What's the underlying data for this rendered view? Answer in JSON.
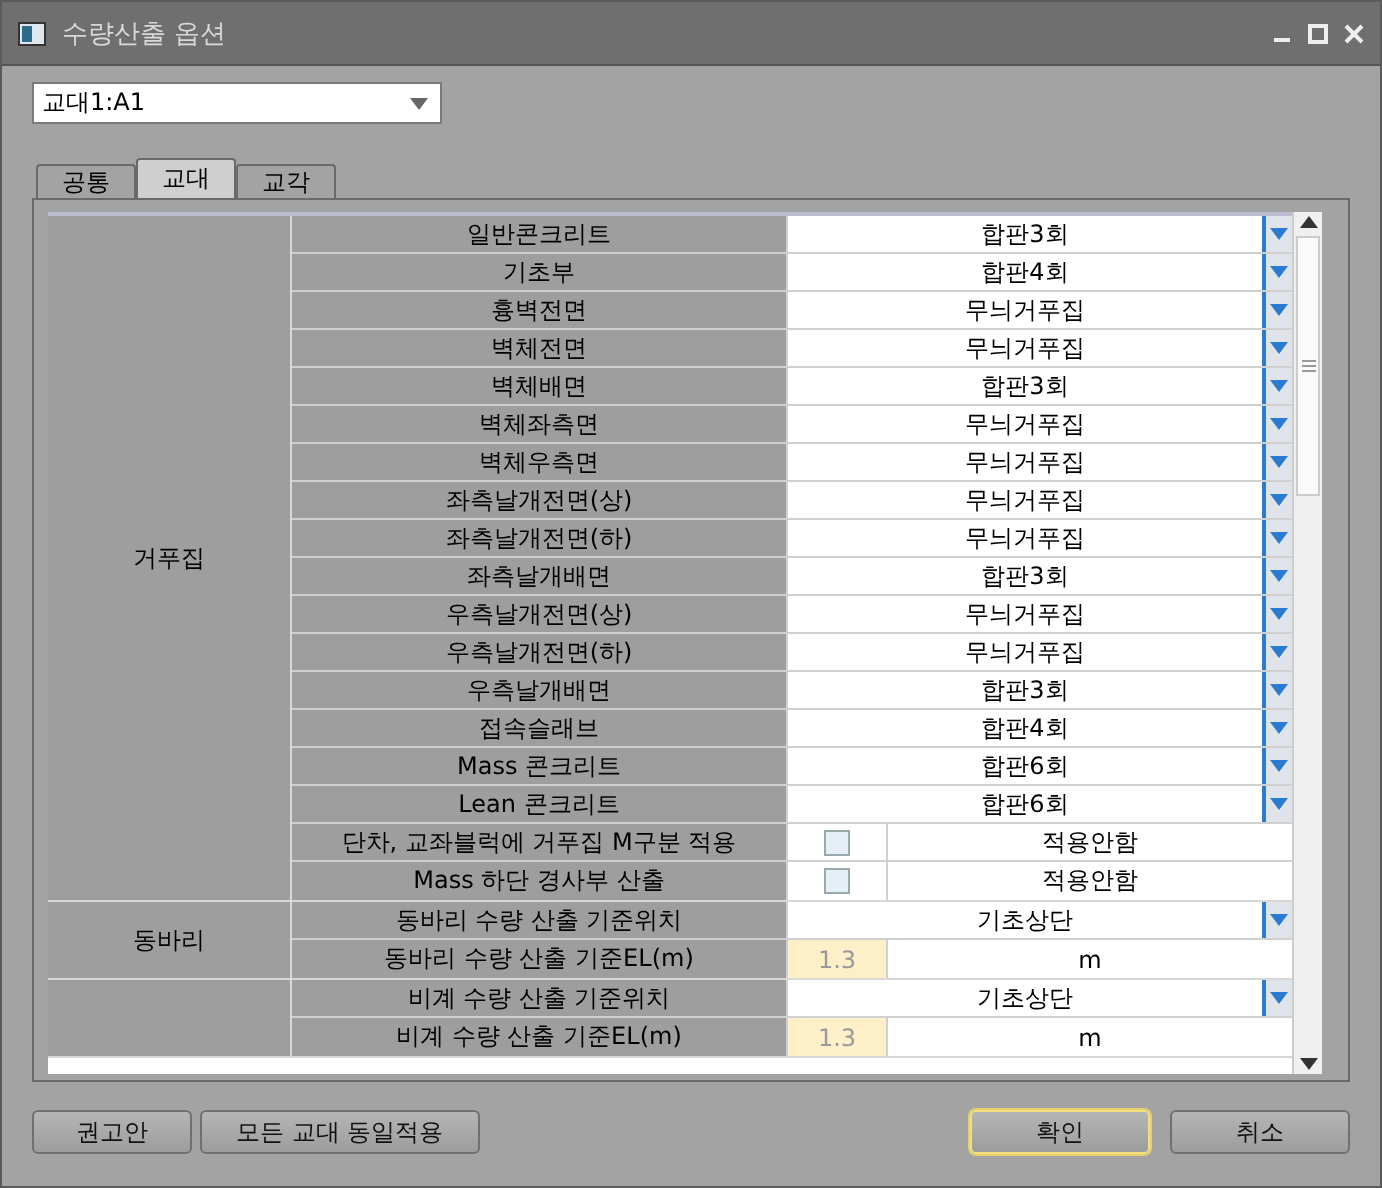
{
  "window": {
    "title": "수량산출 옵션"
  },
  "selector": {
    "value": "교대1:A1"
  },
  "tabs": [
    {
      "label": "공통",
      "selected": false
    },
    {
      "label": "교대",
      "selected": true
    },
    {
      "label": "교각",
      "selected": false
    }
  ],
  "groups": [
    {
      "label": "거푸집",
      "rows": [
        {
          "kind": "dropdown",
          "label": "일반콘크리트",
          "value": "합판3회"
        },
        {
          "kind": "dropdown",
          "label": "기초부",
          "value": "합판4회"
        },
        {
          "kind": "dropdown",
          "label": "흉벽전면",
          "value": "무늬거푸집"
        },
        {
          "kind": "dropdown",
          "label": "벽체전면",
          "value": "무늬거푸집"
        },
        {
          "kind": "dropdown",
          "label": "벽체배면",
          "value": "합판3회"
        },
        {
          "kind": "dropdown",
          "label": "벽체좌측면",
          "value": "무늬거푸집"
        },
        {
          "kind": "dropdown",
          "label": "벽체우측면",
          "value": "무늬거푸집"
        },
        {
          "kind": "dropdown",
          "label": "좌측날개전면(상)",
          "value": "무늬거푸집"
        },
        {
          "kind": "dropdown",
          "label": "좌측날개전면(하)",
          "value": "무늬거푸집"
        },
        {
          "kind": "dropdown",
          "label": "좌측날개배면",
          "value": "합판3회"
        },
        {
          "kind": "dropdown",
          "label": "우측날개전면(상)",
          "value": "무늬거푸집"
        },
        {
          "kind": "dropdown",
          "label": "우측날개전면(하)",
          "value": "무늬거푸집"
        },
        {
          "kind": "dropdown",
          "label": "우측날개배면",
          "value": "합판3회"
        },
        {
          "kind": "dropdown",
          "label": "접속슬래브",
          "value": "합판4회"
        },
        {
          "kind": "dropdown",
          "label": "Mass 콘크리트",
          "value": "합판6회"
        },
        {
          "kind": "dropdown",
          "label": "Lean 콘크리트",
          "value": "합판6회"
        },
        {
          "kind": "checkbox",
          "label": "단차, 교좌블럭에 거푸집 M구분 적용",
          "checked": false,
          "value": "적용안함"
        },
        {
          "kind": "checkbox",
          "label": "Mass 하단 경사부 산출",
          "checked": false,
          "value": "적용안함"
        }
      ]
    },
    {
      "label": "동바리",
      "rows": [
        {
          "kind": "dropdown",
          "label": "동바리 수량 산출 기준위치",
          "value": "기초상단"
        },
        {
          "kind": "number",
          "label": "동바리 수량 산출 기준EL(m)",
          "value": "1.3",
          "disabled": true,
          "unit": "m"
        }
      ]
    },
    {
      "rows": [
        {
          "kind": "dropdown",
          "label": "비계 수량 산출 기준위치",
          "value": "기초상단"
        },
        {
          "kind": "number",
          "label": "비계 수량 산출 기준EL(m)",
          "value": "1.3",
          "disabled": true,
          "unit": "m"
        }
      ]
    }
  ],
  "left_buttons": [
    "권고안",
    "모든 교대 동일적용"
  ],
  "right_buttons": [
    {
      "label": "확인",
      "default": true
    },
    {
      "label": "취소",
      "default": false
    }
  ]
}
